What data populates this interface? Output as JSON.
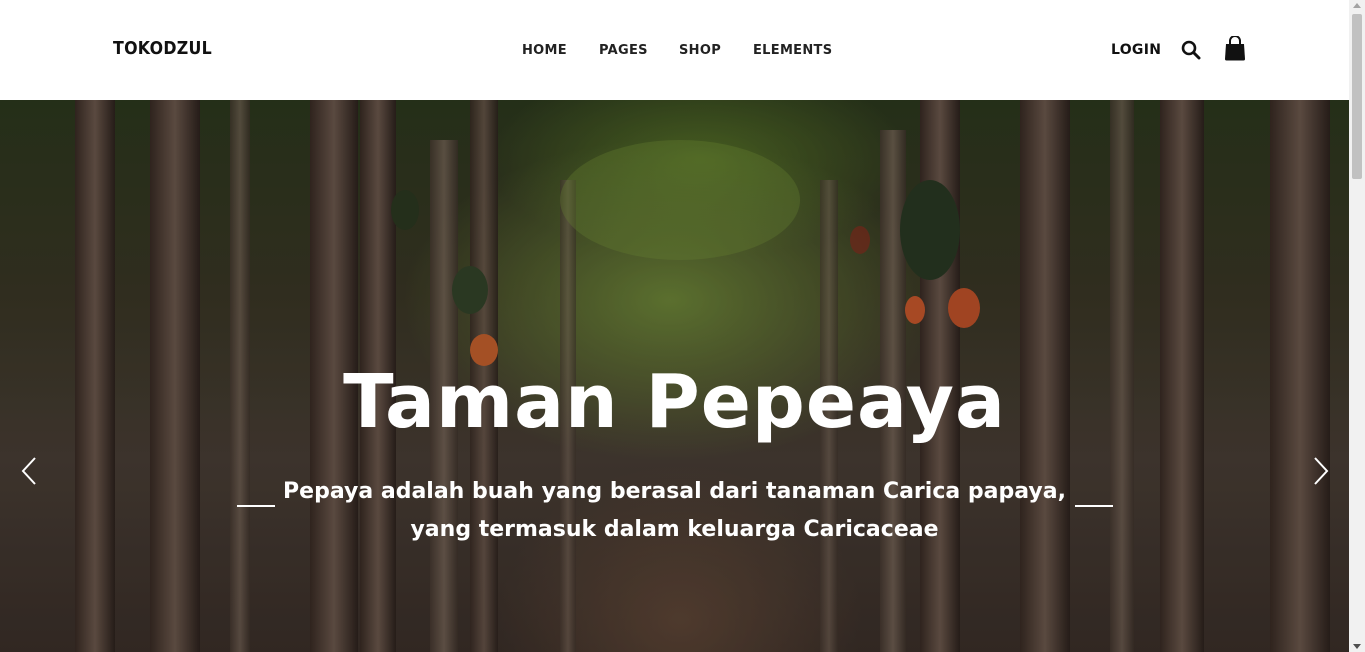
{
  "header": {
    "logo": "TOKODZUL",
    "nav": [
      "HOME",
      "PAGES",
      "SHOP",
      "ELEMENTS"
    ],
    "login_label": "LOGIN",
    "search_icon": "search-icon",
    "cart_icon": "shopping-bag-icon"
  },
  "hero": {
    "title": "Taman Pepeaya",
    "subtitle_line1": "Pepaya adalah buah yang berasal dari tanaman Carica papaya,",
    "subtitle_line2": "yang termasuk dalam keluarga Caricaceae",
    "prev_icon": "chevron-left-icon",
    "next_icon": "chevron-right-icon"
  },
  "colors": {
    "header_bg": "#ffffff",
    "text_dark": "#111111",
    "hero_text": "#ffffff"
  }
}
